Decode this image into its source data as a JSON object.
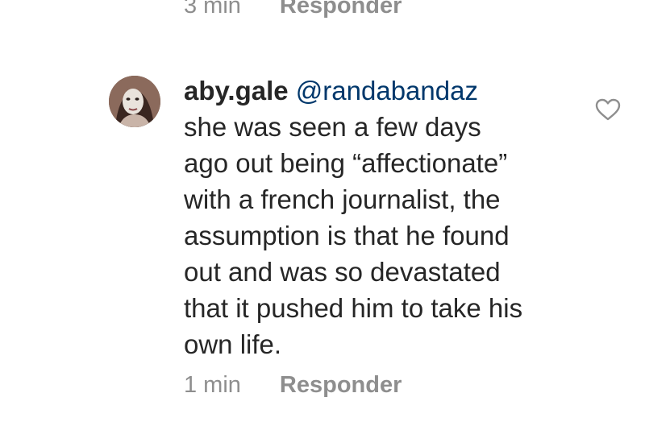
{
  "previous_comment": {
    "time": "3 min",
    "reply_label": "Responder"
  },
  "comment": {
    "username": "aby.gale",
    "mention": "@randabandaz",
    "lines": [
      "she was seen a few days",
      "ago out being “affectionate”",
      "with a french journalist, the",
      "assumption is that he found",
      "out and was so devastated",
      "that it pushed him to take his",
      "own life."
    ],
    "time": "1 min",
    "reply_label": "Responder",
    "avatar_icon": "user-avatar",
    "like_icon": "heart-outline-icon"
  }
}
